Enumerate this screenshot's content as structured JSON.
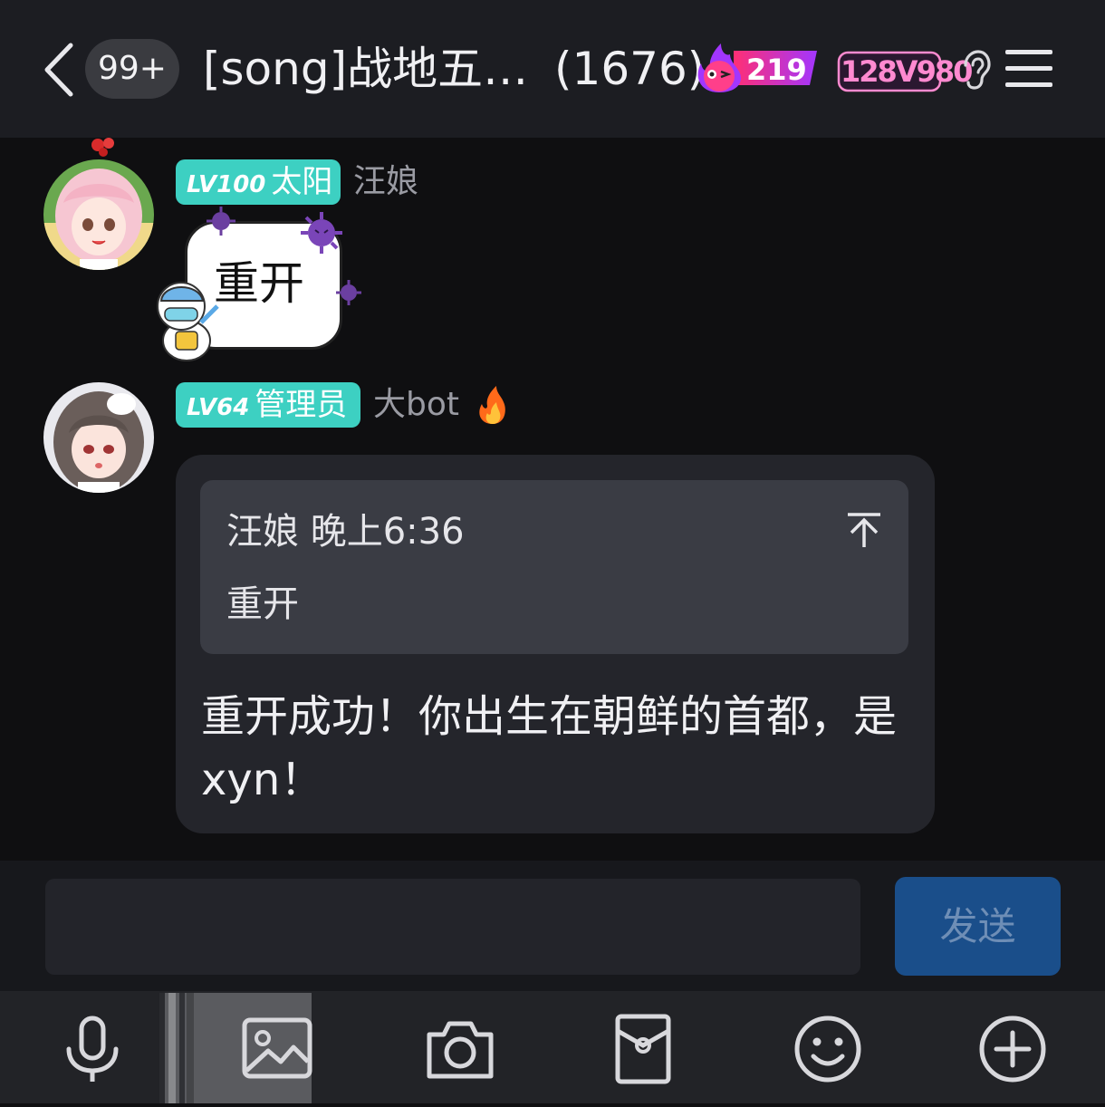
{
  "header": {
    "unread_count": "99+",
    "title": "[song]战地五…",
    "member_count": "(1676)",
    "fire_streak": "219",
    "group_number_badge": "128V980"
  },
  "messages": [
    {
      "level": "LV100",
      "role": "太阳",
      "nickname": "汪娘",
      "sticker_text": "重开"
    },
    {
      "level": "LV64",
      "role": "管理员",
      "nickname": "大bot",
      "quote": {
        "author": "汪娘",
        "time": "晚上6:36",
        "text": "重开"
      },
      "text": "重开成功！你出生在朝鲜的首都，是xyn！"
    }
  ],
  "composer": {
    "send_label": "发送"
  },
  "toolbar": {
    "icons": [
      "microphone-icon",
      "image-icon",
      "camera-icon",
      "red-packet-icon",
      "emoji-icon",
      "plus-icon"
    ]
  },
  "colors": {
    "badge_teal": "#3dd0c2",
    "send_blue": "#1a4e8a",
    "fire_pink": "#ff3fa8"
  }
}
